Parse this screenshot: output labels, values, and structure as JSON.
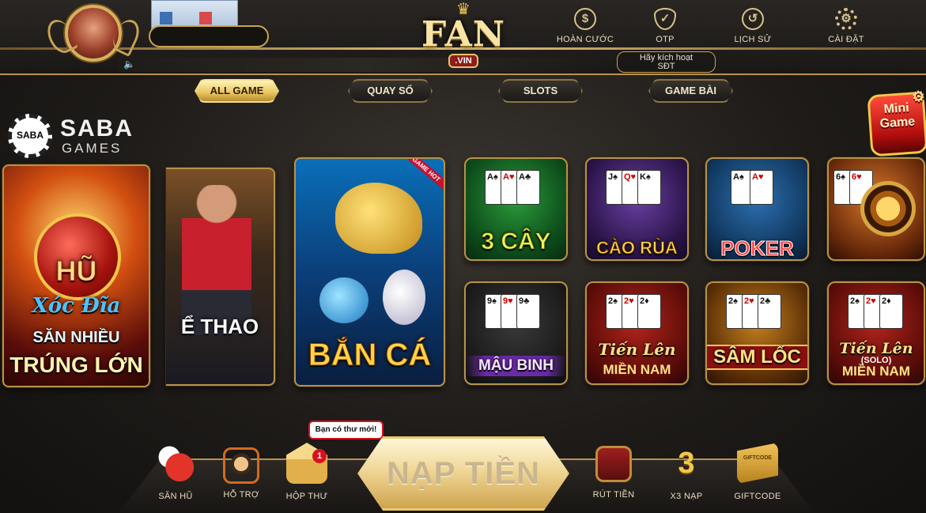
{
  "header": {
    "ad_label": "",
    "name_value": "",
    "menu": [
      {
        "label": "HOÀN CƯỚC",
        "icon": "dollar-coin-icon",
        "glyph": "$"
      },
      {
        "label": "OTP",
        "icon": "shield-check-icon",
        "glyph": "✓"
      },
      {
        "label": "LỊCH SỬ",
        "icon": "history-clock-icon",
        "glyph": "↺"
      },
      {
        "label": "CÀI ĐẶT",
        "icon": "gear-icon",
        "glyph": "⚙"
      }
    ],
    "activate_line1": "Hãy kích hoạt",
    "activate_line2": "SĐT",
    "speaker_glyph": "🔈"
  },
  "logo": {
    "crown": "♛",
    "main": "FAN",
    "sub": ".VIN"
  },
  "tabs": [
    {
      "label": "ALL GAME",
      "active": true
    },
    {
      "label": "QUAY SỐ",
      "active": false
    },
    {
      "label": "SLOTS",
      "active": false
    },
    {
      "label": "GAME BÀI",
      "active": false
    }
  ],
  "brand": {
    "chip": "SABA",
    "line1": "SABA",
    "line2": "GAMES"
  },
  "featured": {
    "hu": {
      "line1": "HŨ",
      "line2": "Xóc Đĩa",
      "line3": "SĂN NHIỀU",
      "line4": "TRÚNG LỚN"
    },
    "thethao": {
      "title": "Ể THAO"
    },
    "banca": {
      "title": "BẮN CÁ",
      "hot": "GAME HOT"
    }
  },
  "games": [
    {
      "label": "3 CÂY"
    },
    {
      "label": "CÀO RÙA"
    },
    {
      "label": "POKER"
    },
    {
      "label": ""
    },
    {
      "label": "MẬU BINH"
    },
    {
      "label": "Tiến Lên",
      "sub": "MIỀN NAM"
    },
    {
      "label": "SÂM LỐC"
    },
    {
      "label": "Tiến Lên",
      "solo": "(SOLO)",
      "sub": "MIỀN NAM"
    }
  ],
  "mini_game": {
    "line1": "Mini",
    "line2": "Game"
  },
  "bottom": {
    "items_left": [
      {
        "label": "SĂN HŨ",
        "icon": "dice-icon"
      },
      {
        "label": "HỖ TRỢ",
        "icon": "headset-support-icon"
      },
      {
        "label": "HỘP THƯ",
        "icon": "mail-envelope-icon",
        "badge": "1"
      }
    ],
    "tooltip": "Bạn có thư mới!",
    "nap_tien": "NẠP TIỀN",
    "items_right": [
      {
        "label": "RÚT TIỀN",
        "icon": "safe-vault-icon"
      },
      {
        "label": "X3 NẠP",
        "icon": "x3-bonus-icon",
        "glyph": "3"
      },
      {
        "label": "GIFTCODE",
        "icon": "giftcode-ticket-icon",
        "glyph": "GIFTCODE"
      }
    ]
  }
}
